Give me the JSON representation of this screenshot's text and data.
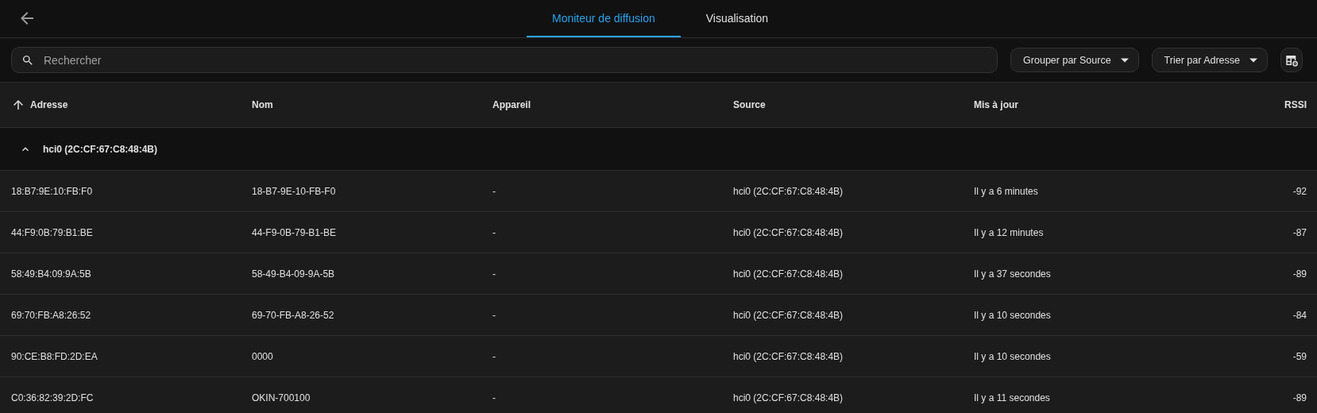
{
  "tabs": [
    {
      "label": "Moniteur de diffusion",
      "selected": true
    },
    {
      "label": "Visualisation",
      "selected": false
    }
  ],
  "search": {
    "placeholder": "Rechercher"
  },
  "toolbar_buttons": [
    {
      "label": "Grouper par Source"
    },
    {
      "label": "Trier par Adresse"
    }
  ],
  "table": {
    "columns": [
      {
        "label": "Adresse",
        "sorted": true
      },
      {
        "label": "Nom",
        "sorted": false
      },
      {
        "label": "Appareil",
        "sorted": false
      },
      {
        "label": "Source",
        "sorted": false
      },
      {
        "label": "Mis à jour",
        "sorted": false
      },
      {
        "label": "RSSI",
        "sorted": false
      }
    ],
    "groups": [
      {
        "label": "hci0 (2C:CF:67:C8:48:4B)",
        "expanded": true,
        "rows": [
          [
            "18:B7:9E:10:FB:F0",
            "18-B7-9E-10-FB-F0",
            "-",
            "hci0 (2C:CF:67:C8:48:4B)",
            "Il y a 6 minutes",
            "-92"
          ],
          [
            "44:F9:0B:79:B1:BE",
            "44-F9-0B-79-B1-BE",
            "-",
            "hci0 (2C:CF:67:C8:48:4B)",
            "Il y a 12 minutes",
            "-87"
          ],
          [
            "58:49:B4:09:9A:5B",
            "58-49-B4-09-9A-5B",
            "-",
            "hci0 (2C:CF:67:C8:48:4B)",
            "Il y a 37 secondes",
            "-89"
          ],
          [
            "69:70:FB:A8:26:52",
            "69-70-FB-A8-26-52",
            "-",
            "hci0 (2C:CF:67:C8:48:4B)",
            "Il y a 10 secondes",
            "-84"
          ],
          [
            "90:CE:B8:FD:2D:EA",
            "0000",
            "-",
            "hci0 (2C:CF:67:C8:48:4B)",
            "Il y a 10 secondes",
            "-59"
          ],
          [
            "C0:36:82:39:2D:FC",
            "OKIN-700100",
            "-",
            "hci0 (2C:CF:67:C8:48:4B)",
            "Il y a 11 secondes",
            "-89"
          ]
        ]
      }
    ]
  }
}
